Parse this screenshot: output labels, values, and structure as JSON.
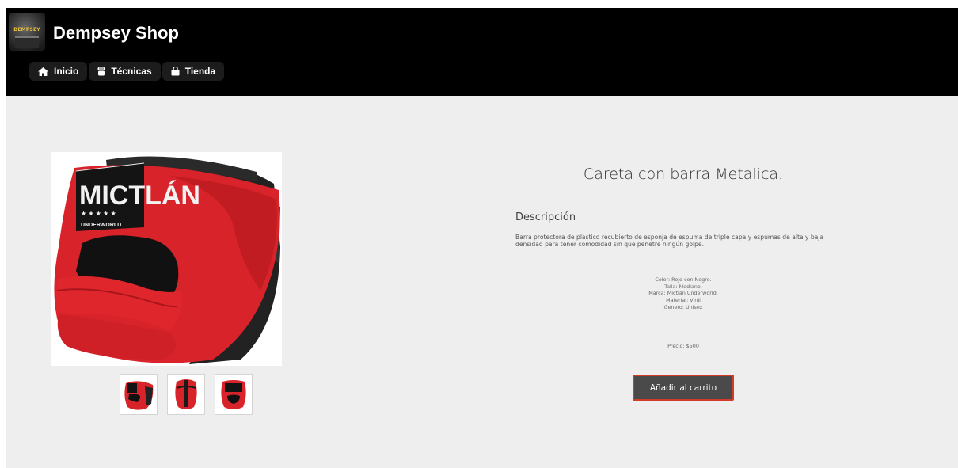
{
  "header": {
    "logo_text": "DEMPSEY",
    "site_title": "Dempsey Shop"
  },
  "nav": [
    {
      "label": "Inicio",
      "icon": "home-icon"
    },
    {
      "label": "Técnicas",
      "icon": "fist-icon"
    },
    {
      "label": "Tienda",
      "icon": "shopping-bag-icon"
    }
  ],
  "gallery": {
    "main_image_text": "MICTLÁN",
    "main_image_subtext": "UNDERWORLD",
    "thumbnails": 3
  },
  "product": {
    "title": "Careta con barra Metalica.",
    "description_heading": "Descripción",
    "description": "Barra protectora de plástico recubierto de esponja de espuma de triple capa y espumas de alta y baja densidad para tener comodidad sin que penetre ningún golpe.",
    "specs": [
      "Color: Rojo con Negro.",
      "Talla: Mediano.",
      "Marca: Mictlán Underworld.",
      "Material: Vinil",
      "Genero: Unisex"
    ],
    "price": "Precio: $500",
    "add_to_cart_label": "Añadir al carrito"
  },
  "colors": {
    "header_bg": "#000000",
    "page_bg": "#eeeeee",
    "button_bg": "#4a4a4a",
    "button_border": "#d23a2a",
    "helmet_red": "#d8232a"
  }
}
